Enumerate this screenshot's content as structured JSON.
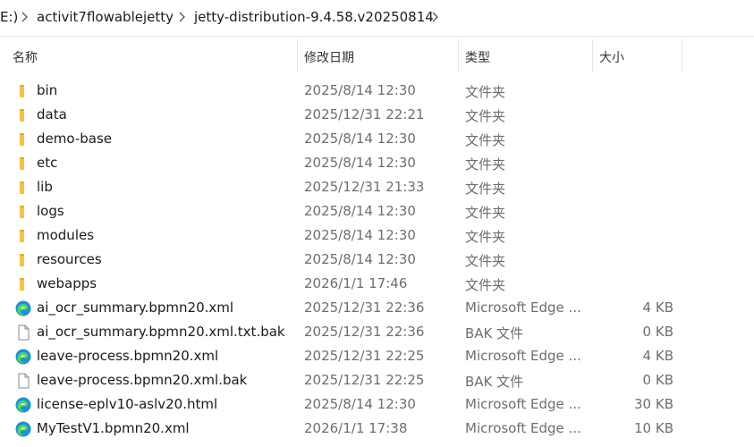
{
  "breadcrumb": {
    "items": [
      "E:)",
      "activit7flowablejetty",
      "jetty-distribution-9.4.58.v20250814"
    ]
  },
  "columns": {
    "name": "名称",
    "modified": "修改日期",
    "type": "类型",
    "size": "大小"
  },
  "files": [
    {
      "name": "bin",
      "modified": "2025/8/14 12:30",
      "type": "文件夹",
      "size": "",
      "icon": "folder-icon"
    },
    {
      "name": "data",
      "modified": "2025/12/31 22:21",
      "type": "文件夹",
      "size": "",
      "icon": "folder-icon"
    },
    {
      "name": "demo-base",
      "modified": "2025/8/14 12:30",
      "type": "文件夹",
      "size": "",
      "icon": "folder-icon"
    },
    {
      "name": "etc",
      "modified": "2025/8/14 12:30",
      "type": "文件夹",
      "size": "",
      "icon": "folder-icon"
    },
    {
      "name": "lib",
      "modified": "2025/12/31 21:33",
      "type": "文件夹",
      "size": "",
      "icon": "folder-icon"
    },
    {
      "name": "logs",
      "modified": "2025/8/14 12:30",
      "type": "文件夹",
      "size": "",
      "icon": "folder-icon"
    },
    {
      "name": "modules",
      "modified": "2025/8/14 12:30",
      "type": "文件夹",
      "size": "",
      "icon": "folder-icon"
    },
    {
      "name": "resources",
      "modified": "2025/8/14 12:30",
      "type": "文件夹",
      "size": "",
      "icon": "folder-icon"
    },
    {
      "name": "webapps",
      "modified": "2026/1/1 17:46",
      "type": "文件夹",
      "size": "",
      "icon": "folder-icon"
    },
    {
      "name": "ai_ocr_summary.bpmn20.xml",
      "modified": "2025/12/31 22:36",
      "type": "Microsoft Edge ...",
      "size": "4 KB",
      "icon": "edge-icon"
    },
    {
      "name": "ai_ocr_summary.bpmn20.xml.txt.bak",
      "modified": "2025/12/31 22:36",
      "type": "BAK 文件",
      "size": "0 KB",
      "icon": "file-icon"
    },
    {
      "name": "leave-process.bpmn20.xml",
      "modified": "2025/12/31 22:25",
      "type": "Microsoft Edge ...",
      "size": "4 KB",
      "icon": "edge-icon"
    },
    {
      "name": "leave-process.bpmn20.xml.bak",
      "modified": "2025/12/31 22:25",
      "type": "BAK 文件",
      "size": "0 KB",
      "icon": "file-icon"
    },
    {
      "name": "license-eplv10-aslv20.html",
      "modified": "2025/8/14 12:30",
      "type": "Microsoft Edge ...",
      "size": "30 KB",
      "icon": "edge-icon"
    },
    {
      "name": "MyTestV1.bpmn20.xml",
      "modified": "2026/1/1 17:38",
      "type": "Microsoft Edge ...",
      "size": "10 KB",
      "icon": "edge-icon"
    }
  ]
}
